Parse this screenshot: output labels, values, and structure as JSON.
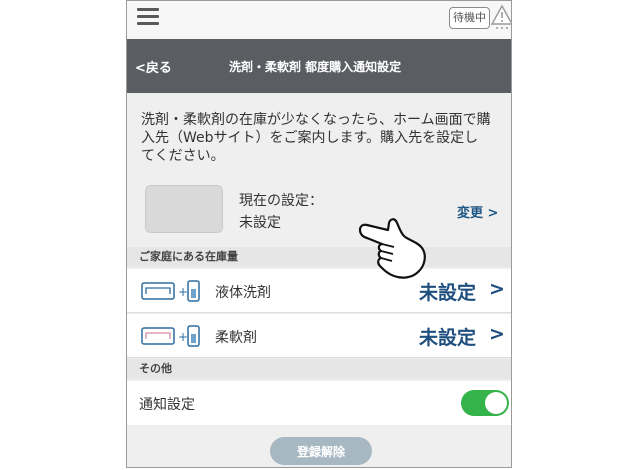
{
  "status_bar": {
    "standby_label": "待機中"
  },
  "header": {
    "back_label": "<戻る",
    "title": "洗剤・柔軟剤 都度購入通知設定"
  },
  "intro_text": "洗剤・柔軟剤の在庫が少なくなったら、ホーム画面で購入先（Webサイト）をご案内します。購入先を設定してください。",
  "current": {
    "label": "現在の設定：",
    "value": "未設定",
    "change_label": "変更 >"
  },
  "stock_section": {
    "title": "ご家庭にある在庫量",
    "items": [
      {
        "label": "液体洗剤",
        "value": "未設定",
        "chevron": ">"
      },
      {
        "label": "柔軟剤",
        "value": "未設定",
        "chevron": ">"
      }
    ]
  },
  "other_section": {
    "title": "その他",
    "notify_label": "通知設定",
    "notify_on": true
  },
  "deregister_label": "登録解除",
  "colors": {
    "header_bg": "#5a5e63",
    "accent_blue": "#1f4f7f",
    "toggle_on": "#34b34a",
    "deregister_bg": "#a7b8c3"
  }
}
